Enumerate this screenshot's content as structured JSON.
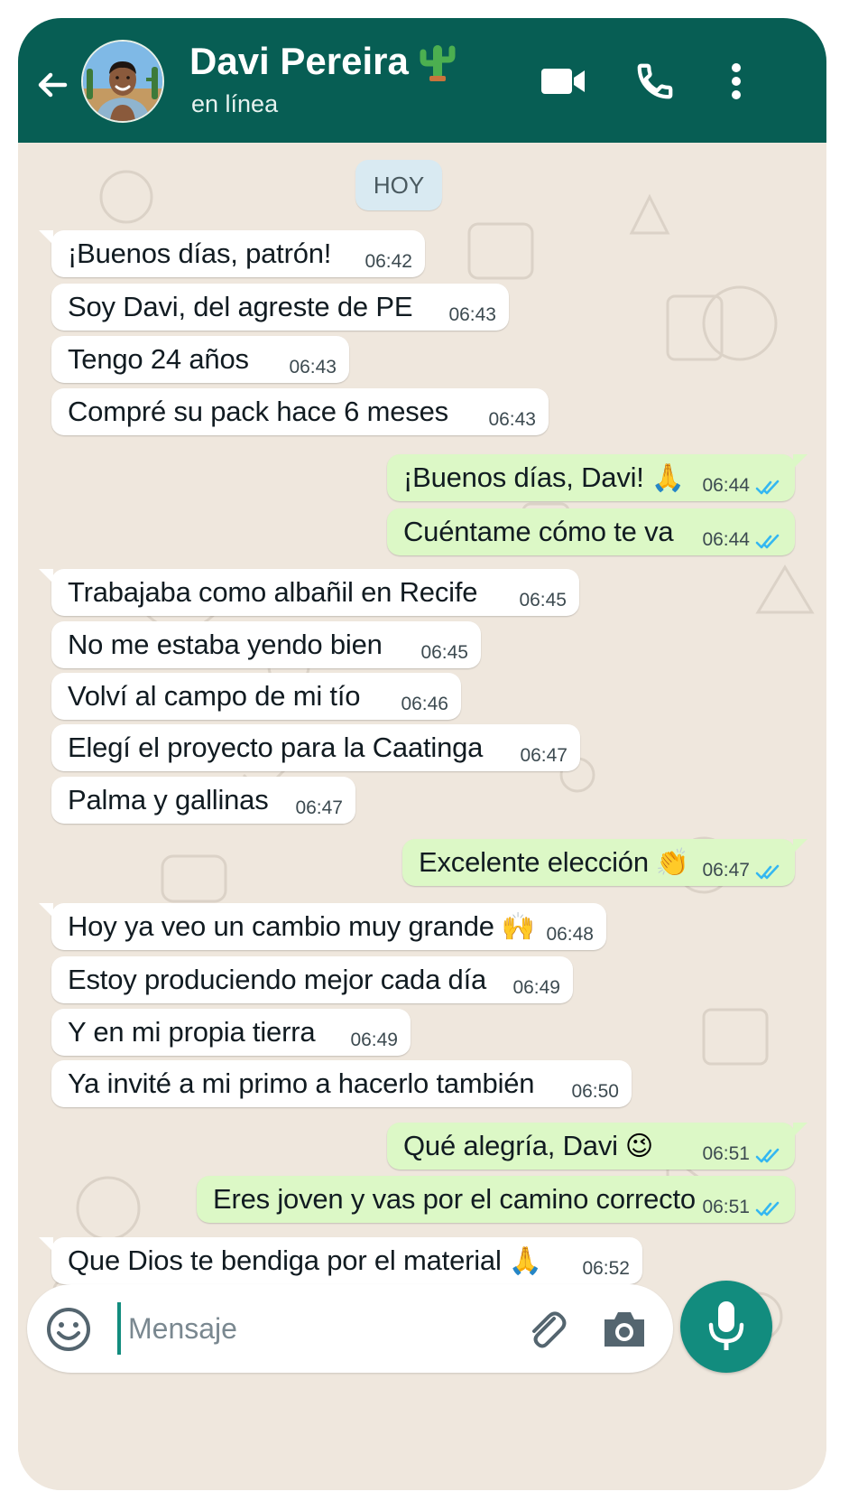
{
  "header": {
    "contact_name": "Davi Pereira",
    "name_emoji": "🌵",
    "status": "en línea",
    "background_color": "#075e54"
  },
  "chat": {
    "date_chip": "HOY",
    "messages": [
      {
        "dir": "in",
        "text": "¡Buenos días, patrón!",
        "emoji": "",
        "time": "06:42"
      },
      {
        "dir": "in",
        "text": "Soy Davi, del agreste de PE",
        "emoji": "",
        "time": "06:43"
      },
      {
        "dir": "in",
        "text": "Tengo 24 años",
        "emoji": "",
        "time": "06:43"
      },
      {
        "dir": "in",
        "text": "Compré su pack hace 6 meses",
        "emoji": "",
        "time": "06:43"
      },
      {
        "dir": "out",
        "text": "¡Buenos días, Davi!",
        "emoji": "🙏",
        "time": "06:44",
        "ticks": "✓✓"
      },
      {
        "dir": "out",
        "text": "Cuéntame cómo te va",
        "emoji": "",
        "time": "06:44",
        "ticks": "✓✓"
      },
      {
        "dir": "in",
        "text": "Trabajaba como albañil en Recife",
        "emoji": "",
        "time": "06:45"
      },
      {
        "dir": "in",
        "text": "No me estaba yendo bien",
        "emoji": "",
        "time": "06:45"
      },
      {
        "dir": "in",
        "text": "Volví al campo de mi tío",
        "emoji": "",
        "time": "06:46"
      },
      {
        "dir": "in",
        "text": "Elegí el proyecto para la Caatinga",
        "emoji": "",
        "time": "06:47"
      },
      {
        "dir": "in",
        "text": "Palma y gallinas",
        "emoji": "",
        "time": "06:47"
      },
      {
        "dir": "out",
        "text": "Excelente elección",
        "emoji": "👏",
        "time": "06:47",
        "ticks": "✓✓"
      },
      {
        "dir": "in",
        "text": "Hoy ya veo un cambio muy grande",
        "emoji": "🙌",
        "time": "06:48"
      },
      {
        "dir": "in",
        "text": "Estoy produciendo mejor cada día",
        "emoji": "",
        "time": "06:49"
      },
      {
        "dir": "in",
        "text": "Y en mi propia tierra",
        "emoji": "",
        "time": "06:49"
      },
      {
        "dir": "in",
        "text": "Ya invité a mi primo a hacerlo también",
        "emoji": "",
        "time": "06:50"
      },
      {
        "dir": "out",
        "text": "Qué alegría, Davi",
        "emoji": "😉",
        "time": "06:51",
        "ticks": "✓✓"
      },
      {
        "dir": "out",
        "text": "Eres joven y vas por el camino correcto",
        "emoji": "",
        "time": "06:51",
        "ticks": "✓✓"
      },
      {
        "dir": "in",
        "text": "Que Dios te bendiga por el material",
        "emoji": "🙏",
        "time": "06:52"
      }
    ]
  },
  "composer": {
    "placeholder": "Mensaje"
  },
  "icons": {
    "back": "arrow-left-icon",
    "video": "video-camera-icon",
    "call": "phone-icon",
    "menu": "more-vertical-icon",
    "emoji": "emoji-icon",
    "attach": "paperclip-icon",
    "camera": "camera-icon",
    "mic": "microphone-icon"
  },
  "colors": {
    "incoming_bubble": "#ffffff",
    "outgoing_bubble": "#dcf8c6",
    "read_ticks": "#34b7f1",
    "accent": "#128c7e"
  }
}
